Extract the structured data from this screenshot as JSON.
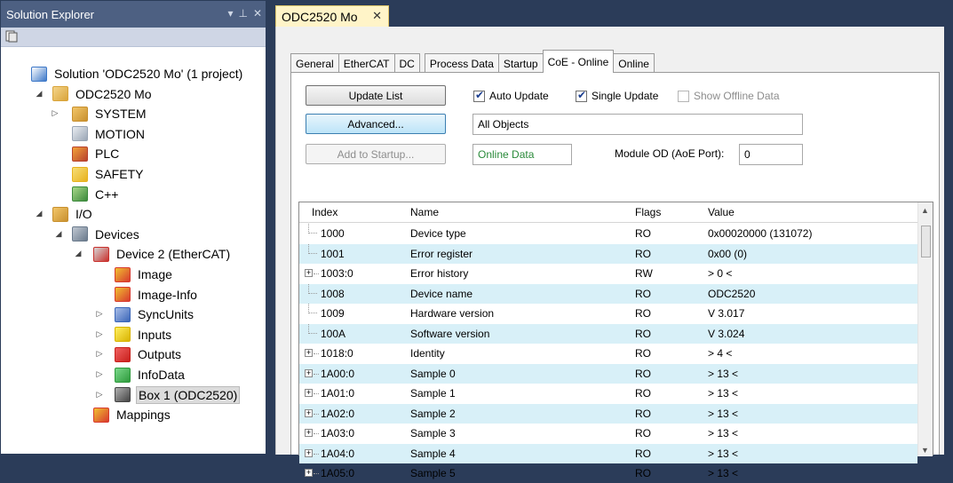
{
  "solution_explorer": {
    "title": "Solution Explorer",
    "pin_glyph": "▾ ᵖ ✕",
    "tree": [
      {
        "label": "Solution 'ODC2520 Mo' (1 project)",
        "icon": "solution-icon"
      },
      {
        "label": "ODC2520 Mo",
        "icon": "project-icon",
        "expander": "◢"
      },
      {
        "label": "SYSTEM",
        "icon": "system-icon",
        "expander": "▷"
      },
      {
        "label": "MOTION",
        "icon": "motion-icon"
      },
      {
        "label": "PLC",
        "icon": "plc-icon"
      },
      {
        "label": "SAFETY",
        "icon": "safety-icon"
      },
      {
        "label": "C++",
        "icon": "cpp-icon"
      },
      {
        "label": "I/O",
        "icon": "io-icon",
        "expander": "◢"
      },
      {
        "label": "Devices",
        "icon": "devices-icon",
        "expander": "◢"
      },
      {
        "label": "Device 2 (EtherCAT)",
        "icon": "ethercat-device-icon",
        "expander": "◢"
      },
      {
        "label": "Image",
        "icon": "image-icon"
      },
      {
        "label": "Image-Info",
        "icon": "image-info-icon"
      },
      {
        "label": "SyncUnits",
        "icon": "syncunits-icon",
        "expander": "▷"
      },
      {
        "label": "Inputs",
        "icon": "inputs-icon",
        "expander": "▷"
      },
      {
        "label": "Outputs",
        "icon": "outputs-icon",
        "expander": "▷"
      },
      {
        "label": "InfoData",
        "icon": "infodata-icon",
        "expander": "▷"
      },
      {
        "label": "Box 1 (ODC2520)",
        "icon": "box-icon",
        "expander": "▷"
      },
      {
        "label": "Mappings",
        "icon": "mappings-icon"
      }
    ]
  },
  "document_tab": {
    "label": "ODC2520 Mo",
    "close": "✕"
  },
  "property_tabs": [
    "General",
    "EtherCAT",
    "DC",
    "Process Data",
    "Startup",
    "CoE - Online",
    "Online"
  ],
  "active_tab": "CoE - Online",
  "controls": {
    "update_list": "Update List",
    "advanced": "Advanced...",
    "add_to_startup": "Add to Startup...",
    "auto_update": "Auto Update",
    "single_update": "Single Update",
    "show_offline_data": "Show Offline Data",
    "object_filter": "All Objects",
    "data_source": "Online Data",
    "module_od_label": "Module OD (AoE Port):",
    "module_od_value": "0"
  },
  "grid": {
    "columns": [
      "Index",
      "Name",
      "Flags",
      "Value"
    ],
    "rows": [
      {
        "index": "1000",
        "name": "Device type",
        "flags": "RO",
        "value": "0x00020000 (131072)",
        "expandable": false
      },
      {
        "index": "1001",
        "name": "Error register",
        "flags": "RO",
        "value": "0x00 (0)",
        "expandable": false
      },
      {
        "index": "1003:0",
        "name": "Error history",
        "flags": "RW",
        "value": "> 0 <",
        "expandable": true
      },
      {
        "index": "1008",
        "name": "Device name",
        "flags": "RO",
        "value": "ODC2520",
        "expandable": false
      },
      {
        "index": "1009",
        "name": "Hardware version",
        "flags": "RO",
        "value": "V 3.017",
        "expandable": false
      },
      {
        "index": "100A",
        "name": "Software version",
        "flags": "RO",
        "value": "V 3.024",
        "expandable": false
      },
      {
        "index": "1018:0",
        "name": "Identity",
        "flags": "RO",
        "value": "> 4 <",
        "expandable": true
      },
      {
        "index": "1A00:0",
        "name": "Sample 0",
        "flags": "RO",
        "value": "> 13 <",
        "expandable": true
      },
      {
        "index": "1A01:0",
        "name": "Sample 1",
        "flags": "RO",
        "value": "> 13 <",
        "expandable": true
      },
      {
        "index": "1A02:0",
        "name": "Sample 2",
        "flags": "RO",
        "value": "> 13 <",
        "expandable": true
      },
      {
        "index": "1A03:0",
        "name": "Sample 3",
        "flags": "RO",
        "value": "> 13 <",
        "expandable": true
      },
      {
        "index": "1A04:0",
        "name": "Sample 4",
        "flags": "RO",
        "value": "> 13 <",
        "expandable": true
      },
      {
        "index": "1A05:0",
        "name": "Sample 5",
        "flags": "RO",
        "value": "> 13 <",
        "expandable": true
      }
    ]
  },
  "colors": {
    "title_bar": "#4d6082",
    "accent_row": "#d8f0f8",
    "doc_tab": "#fff4c8",
    "data_source_text": "#2a8a3a"
  }
}
